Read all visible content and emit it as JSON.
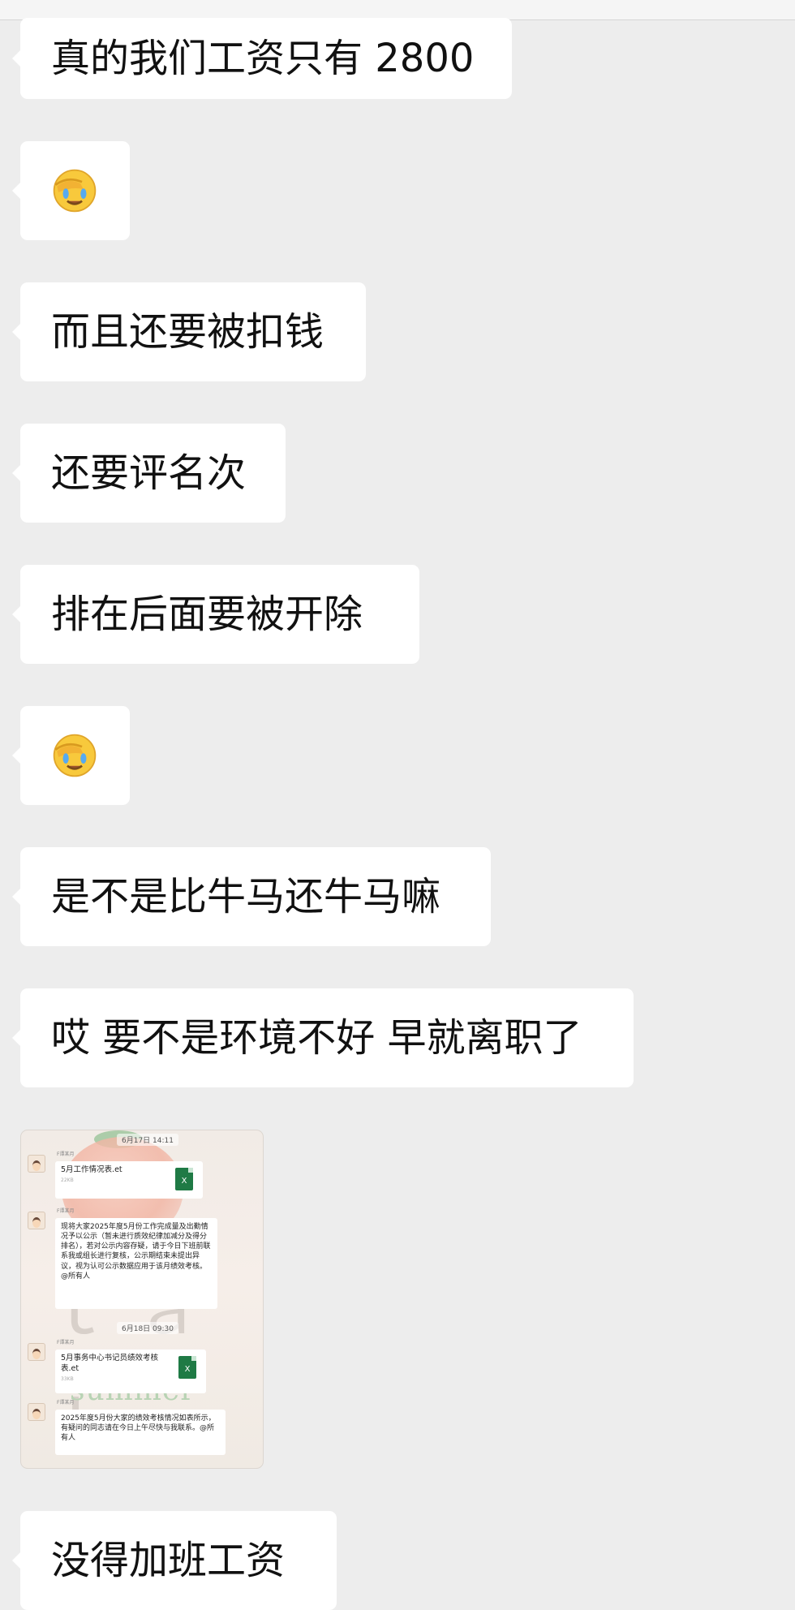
{
  "messages": [
    {
      "type": "text",
      "text": "真的我们工资只有 2800"
    },
    {
      "type": "emoji",
      "emoji": "facepalm-emoji"
    },
    {
      "type": "text",
      "text": "而且还要被扣钱"
    },
    {
      "type": "text",
      "text": "还要评名次"
    },
    {
      "type": "text",
      "text": "排在后面要被开除"
    },
    {
      "type": "emoji",
      "emoji": "facepalm-emoji"
    },
    {
      "type": "text",
      "text": "是不是比牛马还牛马嘛"
    },
    {
      "type": "text",
      "text": "哎 要不是环境不好 早就离职了"
    },
    {
      "type": "image"
    },
    {
      "type": "text",
      "text": "没得加班工资"
    }
  ],
  "screenshot": {
    "date1": "6月17日 14:11",
    "date2": "6月18日 09:30",
    "sender1": "F谭某月",
    "sender2": "F谭某月",
    "sender3": "F谭某月",
    "sender4": "F谭某月",
    "file1_name": "5月工作情况表.et",
    "file1_size": "22KB",
    "notice1": "现将大家2025年度5月份工作完成量及出勤情况予以公示（暂未进行质效纪律加减分及得分排名），若对公示内容存疑，请于今日下班前联系我或组长进行复核，公示期结束未提出异议，视为认可公示数据应用于该月绩效考核。@所有人",
    "file2_name": "5月事务中心书记员绩效考核表.et",
    "file2_size": "33KB",
    "notice2": "2025年度5月份大家的绩效考核情况如表所示，有疑问的同志请在今日上午尽快与我联系。@所有人",
    "xls_label": "X",
    "watermark": "summer"
  },
  "colors": {
    "background": "#ededed",
    "bubble": "#ffffff",
    "text": "#111111"
  }
}
